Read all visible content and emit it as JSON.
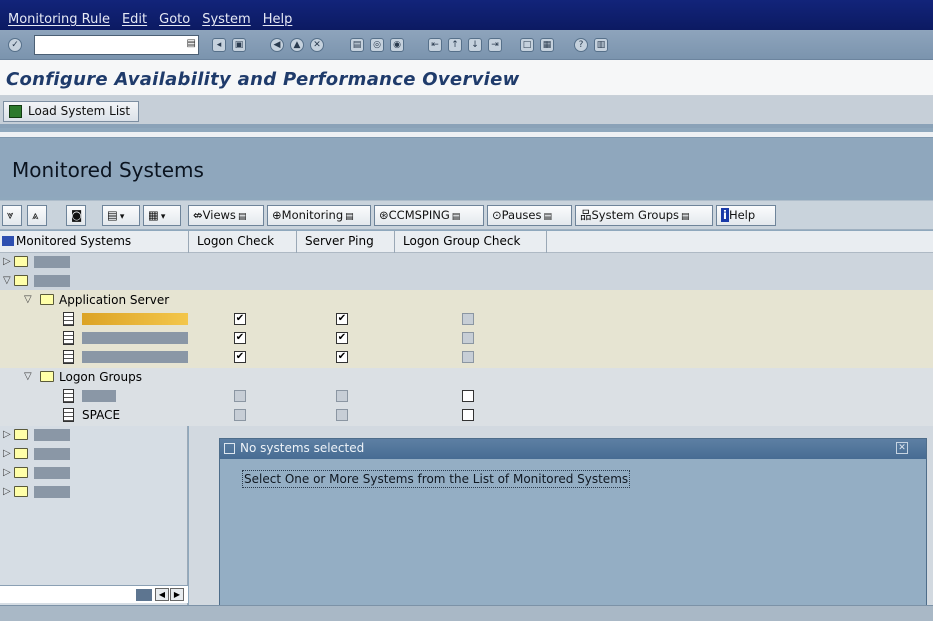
{
  "menu": {
    "items": [
      "Monitoring Rule",
      "Edit",
      "Goto",
      "System",
      "Help"
    ]
  },
  "command_field": {
    "value": ""
  },
  "page_title": "Configure Availability and Performance Overview",
  "app_toolbar": {
    "load_system_list": "Load System List"
  },
  "section_title": "Monitored Systems",
  "tree_toolbar": {
    "views": "Views",
    "monitoring": "Monitoring",
    "ccmsping": "CCMSPING",
    "pauses": "Pauses",
    "system_groups": "System Groups",
    "help": "Help"
  },
  "columns": [
    "Monitored Systems",
    "Logon Check",
    "Server Ping",
    "Logon Group Check"
  ],
  "tree": {
    "application_servers": "Application Server",
    "logon_groups": "Logon Groups",
    "space": "SPACE"
  },
  "popup": {
    "title": "No systems selected",
    "message": "Select One or More Systems from the List of Monitored Systems"
  },
  "icons": [
    "command-ok-icon",
    "save-icon",
    "back-icon",
    "exit-icon",
    "cancel-icon",
    "print-icon",
    "find-icon",
    "help-icon",
    "folder-icon",
    "document-icon"
  ]
}
